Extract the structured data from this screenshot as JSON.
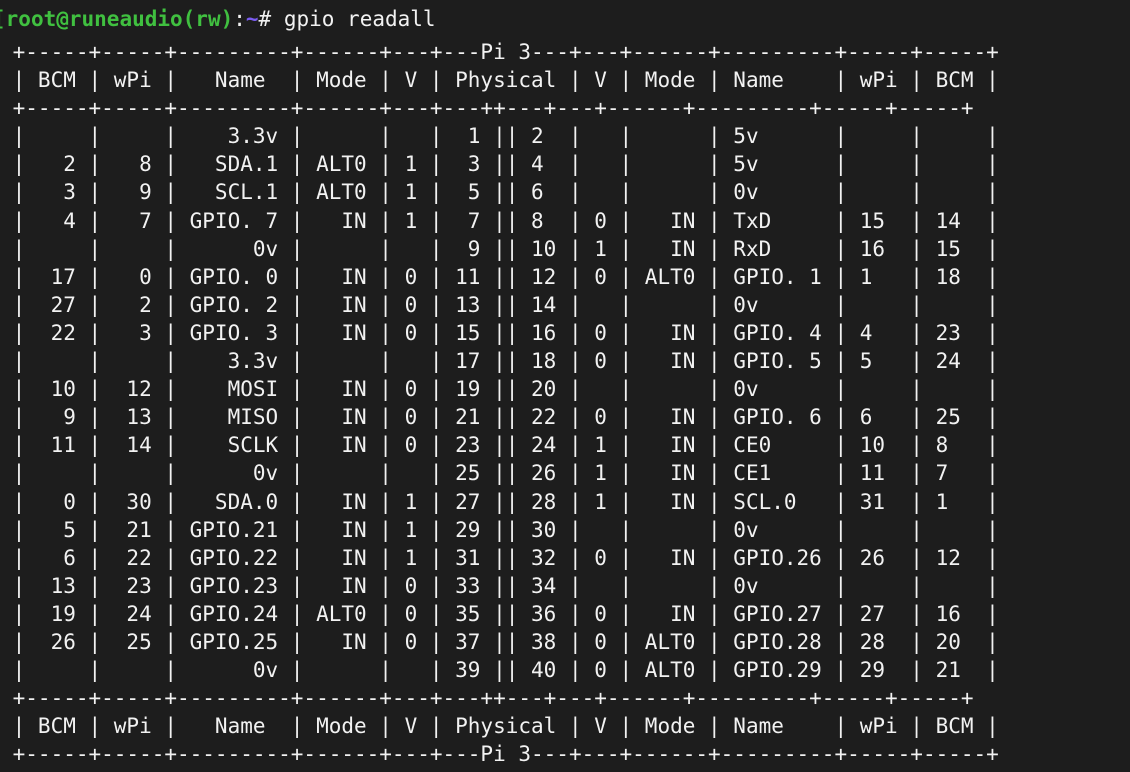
{
  "terminal": {
    "background_color": "#1d1d1d",
    "foreground_color": "#f2f2f2",
    "prompt_user_host_color": "#40c040",
    "prompt_path_color": "#7a5cf0",
    "columns": 68,
    "rows": 28
  },
  "prompt": {
    "bracket_open": "[",
    "user_host": "root@runeaudio(rw)",
    "colon": ":",
    "path": "~",
    "sigil": "#",
    "command": " gpio readall"
  },
  "table": {
    "board_label": "Pi 3",
    "headers": [
      "BCM",
      "wPi",
      "Name",
      "Mode",
      "V",
      "Physical",
      "V",
      "Mode",
      "Name",
      "wPi",
      "BCM"
    ],
    "separator_top": " +-----+-----+---------+------+---+---Pi 3---+---+------+---------+-----+-----+",
    "separator_mid": " +-----+-----+---------+------+---+---++---+---+------+---------+-----+-----+",
    "separator_bottom": " +-----+-----+---------+------+---+---Pi 3---+---+------+---------+-----+-----+",
    "header_row": " | BCM | wPi |   Name  | Mode | V | Physical | V | Mode | Name    | wPi | BCM |",
    "rows": [
      {
        "bcm_l": "",
        "wpi_l": "",
        "name_l": "3.3v",
        "mode_l": "",
        "v_l": "",
        "phys_l": "1",
        "phys_r": "2",
        "v_r": "",
        "mode_r": "",
        "name_r": "5v",
        "wpi_r": "",
        "bcm_r": ""
      },
      {
        "bcm_l": "2",
        "wpi_l": "8",
        "name_l": "SDA.1",
        "mode_l": "ALT0",
        "v_l": "1",
        "phys_l": "3",
        "phys_r": "4",
        "v_r": "",
        "mode_r": "",
        "name_r": "5v",
        "wpi_r": "",
        "bcm_r": ""
      },
      {
        "bcm_l": "3",
        "wpi_l": "9",
        "name_l": "SCL.1",
        "mode_l": "ALT0",
        "v_l": "1",
        "phys_l": "5",
        "phys_r": "6",
        "v_r": "",
        "mode_r": "",
        "name_r": "0v",
        "wpi_r": "",
        "bcm_r": ""
      },
      {
        "bcm_l": "4",
        "wpi_l": "7",
        "name_l": "GPIO. 7",
        "mode_l": "IN",
        "v_l": "1",
        "phys_l": "7",
        "phys_r": "8",
        "v_r": "0",
        "mode_r": "IN",
        "name_r": "TxD",
        "wpi_r": "15",
        "bcm_r": "14"
      },
      {
        "bcm_l": "",
        "wpi_l": "",
        "name_l": "0v",
        "mode_l": "",
        "v_l": "",
        "phys_l": "9",
        "phys_r": "10",
        "v_r": "1",
        "mode_r": "IN",
        "name_r": "RxD",
        "wpi_r": "16",
        "bcm_r": "15"
      },
      {
        "bcm_l": "17",
        "wpi_l": "0",
        "name_l": "GPIO. 0",
        "mode_l": "IN",
        "v_l": "0",
        "phys_l": "11",
        "phys_r": "12",
        "v_r": "0",
        "mode_r": "ALT0",
        "name_r": "GPIO. 1",
        "wpi_r": "1",
        "bcm_r": "18"
      },
      {
        "bcm_l": "27",
        "wpi_l": "2",
        "name_l": "GPIO. 2",
        "mode_l": "IN",
        "v_l": "0",
        "phys_l": "13",
        "phys_r": "14",
        "v_r": "",
        "mode_r": "",
        "name_r": "0v",
        "wpi_r": "",
        "bcm_r": ""
      },
      {
        "bcm_l": "22",
        "wpi_l": "3",
        "name_l": "GPIO. 3",
        "mode_l": "IN",
        "v_l": "0",
        "phys_l": "15",
        "phys_r": "16",
        "v_r": "0",
        "mode_r": "IN",
        "name_r": "GPIO. 4",
        "wpi_r": "4",
        "bcm_r": "23"
      },
      {
        "bcm_l": "",
        "wpi_l": "",
        "name_l": "3.3v",
        "mode_l": "",
        "v_l": "",
        "phys_l": "17",
        "phys_r": "18",
        "v_r": "0",
        "mode_r": "IN",
        "name_r": "GPIO. 5",
        "wpi_r": "5",
        "bcm_r": "24"
      },
      {
        "bcm_l": "10",
        "wpi_l": "12",
        "name_l": "MOSI",
        "mode_l": "IN",
        "v_l": "0",
        "phys_l": "19",
        "phys_r": "20",
        "v_r": "",
        "mode_r": "",
        "name_r": "0v",
        "wpi_r": "",
        "bcm_r": ""
      },
      {
        "bcm_l": "9",
        "wpi_l": "13",
        "name_l": "MISO",
        "mode_l": "IN",
        "v_l": "0",
        "phys_l": "21",
        "phys_r": "22",
        "v_r": "0",
        "mode_r": "IN",
        "name_r": "GPIO. 6",
        "wpi_r": "6",
        "bcm_r": "25"
      },
      {
        "bcm_l": "11",
        "wpi_l": "14",
        "name_l": "SCLK",
        "mode_l": "IN",
        "v_l": "0",
        "phys_l": "23",
        "phys_r": "24",
        "v_r": "1",
        "mode_r": "IN",
        "name_r": "CE0",
        "wpi_r": "10",
        "bcm_r": "8"
      },
      {
        "bcm_l": "",
        "wpi_l": "",
        "name_l": "0v",
        "mode_l": "",
        "v_l": "",
        "phys_l": "25",
        "phys_r": "26",
        "v_r": "1",
        "mode_r": "IN",
        "name_r": "CE1",
        "wpi_r": "11",
        "bcm_r": "7"
      },
      {
        "bcm_l": "0",
        "wpi_l": "30",
        "name_l": "SDA.0",
        "mode_l": "IN",
        "v_l": "1",
        "phys_l": "27",
        "phys_r": "28",
        "v_r": "1",
        "mode_r": "IN",
        "name_r": "SCL.0",
        "wpi_r": "31",
        "bcm_r": "1"
      },
      {
        "bcm_l": "5",
        "wpi_l": "21",
        "name_l": "GPIO.21",
        "mode_l": "IN",
        "v_l": "1",
        "phys_l": "29",
        "phys_r": "30",
        "v_r": "",
        "mode_r": "",
        "name_r": "0v",
        "wpi_r": "",
        "bcm_r": ""
      },
      {
        "bcm_l": "6",
        "wpi_l": "22",
        "name_l": "GPIO.22",
        "mode_l": "IN",
        "v_l": "1",
        "phys_l": "31",
        "phys_r": "32",
        "v_r": "0",
        "mode_r": "IN",
        "name_r": "GPIO.26",
        "wpi_r": "26",
        "bcm_r": "12"
      },
      {
        "bcm_l": "13",
        "wpi_l": "23",
        "name_l": "GPIO.23",
        "mode_l": "IN",
        "v_l": "0",
        "phys_l": "33",
        "phys_r": "34",
        "v_r": "",
        "mode_r": "",
        "name_r": "0v",
        "wpi_r": "",
        "bcm_r": ""
      },
      {
        "bcm_l": "19",
        "wpi_l": "24",
        "name_l": "GPIO.24",
        "mode_l": "ALT0",
        "v_l": "0",
        "phys_l": "35",
        "phys_r": "36",
        "v_r": "0",
        "mode_r": "IN",
        "name_r": "GPIO.27",
        "wpi_r": "27",
        "bcm_r": "16"
      },
      {
        "bcm_l": "26",
        "wpi_l": "25",
        "name_l": "GPIO.25",
        "mode_l": "IN",
        "v_l": "0",
        "phys_l": "37",
        "phys_r": "38",
        "v_r": "0",
        "mode_r": "ALT0",
        "name_r": "GPIO.28",
        "wpi_r": "28",
        "bcm_r": "20"
      },
      {
        "bcm_l": "",
        "wpi_l": "",
        "name_l": "0v",
        "mode_l": "",
        "v_l": "",
        "phys_l": "39",
        "phys_r": "40",
        "v_r": "0",
        "mode_r": "ALT0",
        "name_r": "GPIO.29",
        "wpi_r": "29",
        "bcm_r": "21"
      }
    ]
  }
}
